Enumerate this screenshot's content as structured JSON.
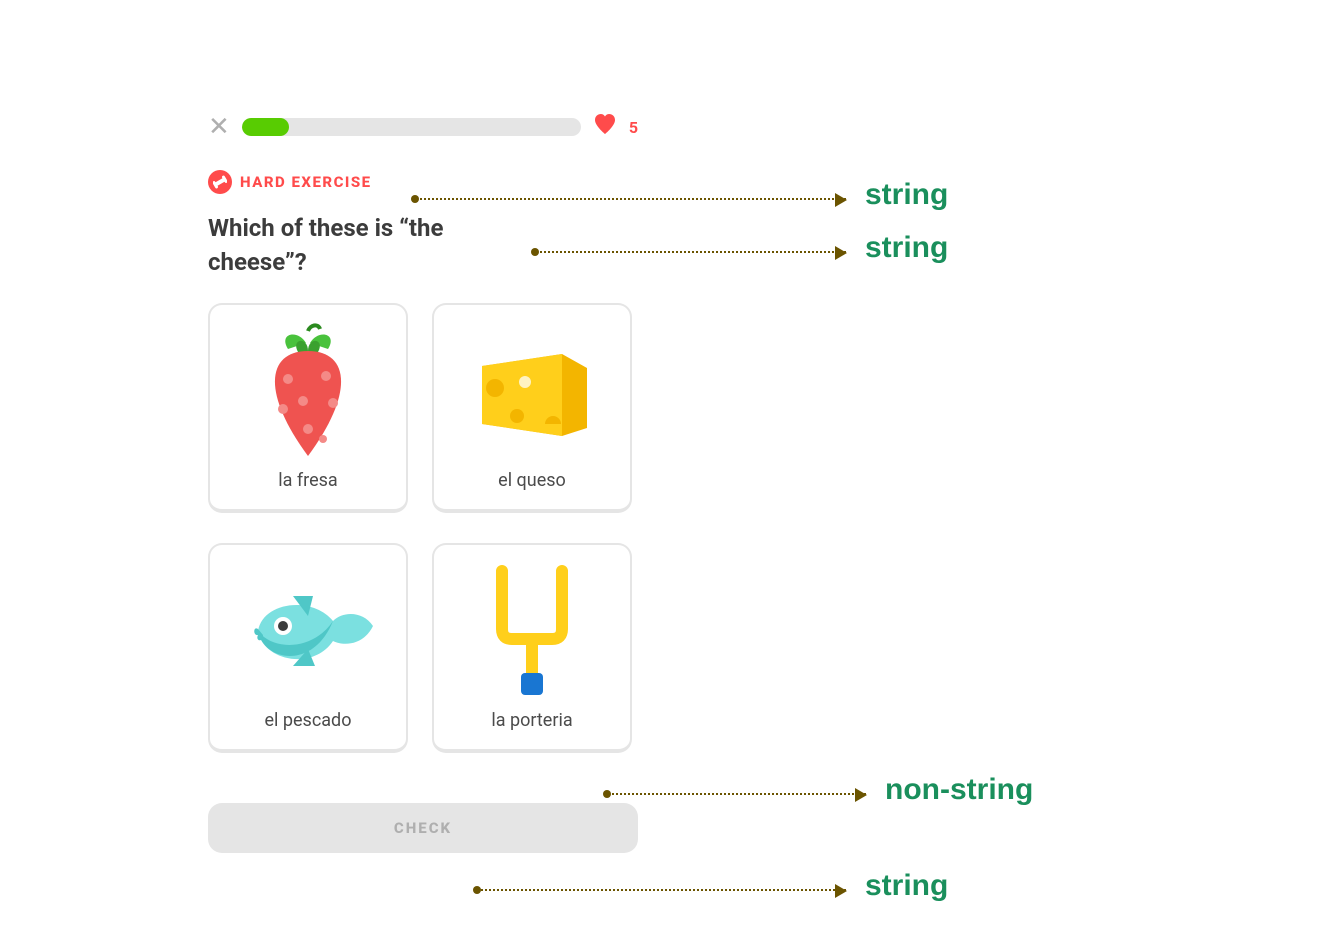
{
  "header": {
    "hearts": "5",
    "progress_percent": 14
  },
  "badge": {
    "label": "HARD EXERCISE"
  },
  "question": "Which of these is “the cheese”?",
  "options": [
    {
      "label": "la fresa",
      "icon": "strawberry-icon"
    },
    {
      "label": "el queso",
      "icon": "cheese-icon"
    },
    {
      "label": "el pescado",
      "icon": "fish-icon"
    },
    {
      "label": "la porteria",
      "icon": "goalpost-icon"
    }
  ],
  "check_button": "CHECK",
  "annotations": [
    {
      "target": "badge",
      "label": "string"
    },
    {
      "target": "question",
      "label": "string"
    },
    {
      "target": "option-card",
      "label": "non-string"
    },
    {
      "target": "check-button",
      "label": "string"
    }
  ],
  "colors": {
    "accent_green": "#58cc02",
    "accent_red": "#ff4b4b",
    "annot_green": "#1a8f5c",
    "arrow_brown": "#6b5400"
  }
}
